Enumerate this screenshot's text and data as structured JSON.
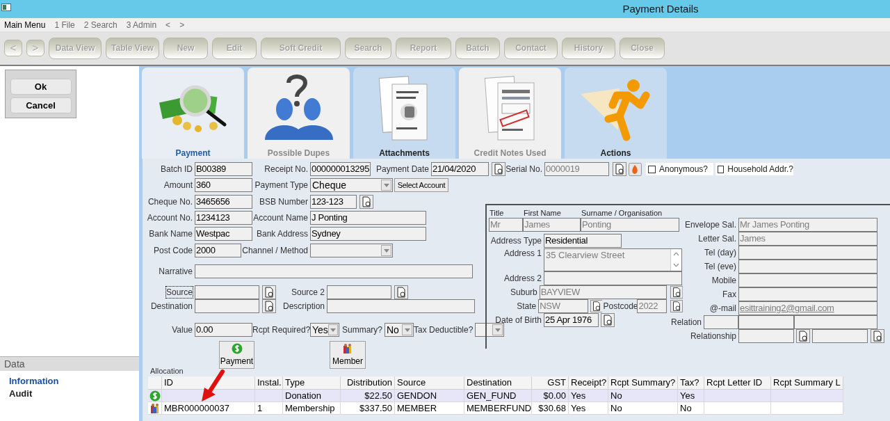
{
  "window": {
    "title": "Payment Details"
  },
  "menu": [
    {
      "label": "Main Menu",
      "selected": true
    },
    {
      "label": "1 File",
      "selected": false
    },
    {
      "label": "2 Search",
      "selected": false
    },
    {
      "label": "3 Admin",
      "selected": false
    },
    {
      "label": "<",
      "selected": false
    },
    {
      "label": ">",
      "selected": false
    }
  ],
  "toolbar": [
    {
      "label": "<",
      "kind": "nav",
      "disabled": true
    },
    {
      "label": ">",
      "kind": "nav",
      "disabled": true
    },
    {
      "label": "Data View",
      "kind": "button",
      "disabled": true
    },
    {
      "label": "Table View",
      "kind": "button",
      "disabled": true
    },
    {
      "label": "New",
      "kind": "button",
      "disabled": true
    },
    {
      "label": "Edit",
      "kind": "button",
      "disabled": true
    },
    {
      "label": "Soft Credit",
      "kind": "button",
      "disabled": true
    },
    {
      "label": "Search",
      "kind": "button",
      "disabled": true
    },
    {
      "label": "Report",
      "kind": "button",
      "disabled": true
    },
    {
      "label": "Batch",
      "kind": "button",
      "disabled": true
    },
    {
      "label": "Contact",
      "kind": "button",
      "disabled": true
    },
    {
      "label": "History",
      "kind": "button",
      "disabled": true
    },
    {
      "label": "Close",
      "kind": "button",
      "disabled": true
    }
  ],
  "dialog_buttons": [
    "Ok",
    "Cancel"
  ],
  "sidebar": {
    "header": "Data",
    "items": [
      {
        "label": "Information",
        "selected": true
      },
      {
        "label": "Audit",
        "selected": false
      }
    ]
  },
  "tabs": [
    {
      "label": "Payment",
      "selected": true,
      "disabled": false
    },
    {
      "label": "Possible Dupes",
      "selected": false,
      "disabled": true
    },
    {
      "label": "Attachments",
      "selected": false,
      "disabled": false
    },
    {
      "label": "Credit Notes Used",
      "selected": false,
      "disabled": true
    },
    {
      "label": "Actions",
      "selected": false,
      "disabled": false
    }
  ],
  "form": {
    "rows": [
      {
        "items": [
          {
            "kind": "label",
            "text": "Batch ID"
          },
          {
            "kind": "field",
            "value": "B00389",
            "disabled": false
          },
          {
            "kind": "label",
            "text": "Receipt No."
          },
          {
            "kind": "field",
            "value": "000000013295",
            "disabled": false
          },
          {
            "kind": "label",
            "text": "Payment Date"
          },
          {
            "kind": "field",
            "value": "21/04/2020",
            "disabled": false
          },
          {
            "kind": "lookup"
          },
          {
            "kind": "label",
            "text": "Serial No."
          },
          {
            "kind": "field",
            "value": "0000019",
            "disabled": true
          },
          {
            "kind": "lookup"
          },
          {
            "kind": "action"
          },
          {
            "kind": "checkbox",
            "text": "Anonymous?",
            "checked": false
          },
          {
            "kind": "checkbox",
            "text": "Household Addr.?",
            "checked": false
          }
        ]
      },
      {
        "items": [
          {
            "kind": "label",
            "text": "Amount"
          },
          {
            "kind": "field",
            "value": "360",
            "disabled": false
          },
          {
            "kind": "label",
            "text": "Payment Type"
          },
          {
            "kind": "select",
            "value": "Cheque"
          },
          {
            "kind": "button",
            "text": "Select Account"
          }
        ]
      },
      {
        "items": [
          {
            "kind": "label",
            "text": "Cheque No."
          },
          {
            "kind": "field",
            "value": "3465656",
            "disabled": false
          },
          {
            "kind": "label",
            "text": "BSB Number"
          },
          {
            "kind": "field",
            "value": "123-123",
            "disabled": false
          },
          {
            "kind": "lookup"
          }
        ]
      },
      {
        "items": [
          {
            "kind": "label",
            "text": "Account No."
          },
          {
            "kind": "field",
            "value": "1234123",
            "disabled": false
          },
          {
            "kind": "label",
            "text": "Account Name"
          },
          {
            "kind": "field",
            "value": "J Ponting",
            "disabled": false
          }
        ]
      },
      {
        "items": [
          {
            "kind": "label",
            "text": "Bank Name"
          },
          {
            "kind": "field",
            "value": "Westpac",
            "disabled": false
          },
          {
            "kind": "label",
            "text": "Bank Address"
          },
          {
            "kind": "field",
            "value": "Sydney",
            "disabled": false
          }
        ]
      },
      {
        "items": [
          {
            "kind": "label",
            "text": "Post Code"
          },
          {
            "kind": "field",
            "value": "2000",
            "disabled": false
          },
          {
            "kind": "label",
            "text": "Channel / Method"
          },
          {
            "kind": "select"
          }
        ]
      },
      {
        "items": [
          {
            "kind": "label",
            "text": "Narrative"
          },
          {
            "kind": "field"
          }
        ]
      },
      {
        "items": [
          {
            "kind": "label",
            "text": "Source",
            "focused": true
          },
          {
            "kind": "field"
          },
          {
            "kind": "lookup"
          },
          {
            "kind": "label",
            "text": "Source 2"
          },
          {
            "kind": "field"
          },
          {
            "kind": "lookup"
          }
        ]
      },
      {
        "items": [
          {
            "kind": "label",
            "text": "Destination"
          },
          {
            "kind": "field"
          },
          {
            "kind": "lookup"
          },
          {
            "kind": "label",
            "text": "Description"
          },
          {
            "kind": "field"
          }
        ]
      },
      {
        "items": [
          {
            "kind": "label",
            "text": "Value"
          },
          {
            "kind": "field",
            "value": "0.00",
            "disabled": false
          },
          {
            "kind": "label",
            "text": "Rcpt Required?"
          },
          {
            "kind": "select",
            "value": "Yes"
          },
          {
            "kind": "label",
            "text": "Summary?"
          },
          {
            "kind": "select",
            "value": "No"
          },
          {
            "kind": "label",
            "text": "Tax Deductible?"
          },
          {
            "kind": "select"
          }
        ]
      }
    ]
  },
  "contact": {
    "name_labels": [
      "Title",
      "First Name",
      "Surname / Organisation"
    ],
    "name_values": [
      {
        "value": "Mr",
        "disabled": true
      },
      {
        "value": "James",
        "disabled": true
      },
      {
        "value": "Ponting",
        "disabled": true
      }
    ],
    "address_type": {
      "label": "Address Type",
      "value": "Residential",
      "disabled": false
    },
    "address1": {
      "label": "Address 1",
      "value": "35 Clearview Street",
      "disabled": true
    },
    "address2": {
      "label": "Address 2"
    },
    "suburb": {
      "label": "Suburb",
      "value": "BAYVIEW",
      "disabled": true
    },
    "state": {
      "label": "State",
      "value": "NSW",
      "disabled": true
    },
    "postcode": {
      "label": "Postcode",
      "value": "2022",
      "disabled": true
    },
    "dob": {
      "label": "Date of Birth",
      "value": "25 Apr 1976",
      "disabled": false
    },
    "right_fields": [
      {
        "label": "Envelope Sal.",
        "value": "Mr James Ponting",
        "kind": "text"
      },
      {
        "label": "Letter Sal.",
        "value": "James",
        "kind": "text"
      },
      {
        "label": "Tel (day)",
        "kind": "text"
      },
      {
        "label": "Tel (eve)",
        "kind": "text"
      },
      {
        "label": "Mobile",
        "kind": "text"
      },
      {
        "label": "Fax",
        "kind": "text"
      },
      {
        "label": "@-mail",
        "value": "esittraining2@gmail.com",
        "kind": "link"
      }
    ],
    "relation_label": "Relation",
    "relationship_label": "Relationship"
  },
  "allocation": {
    "buttons": [
      {
        "label": "Payment",
        "kind": "payment"
      },
      {
        "label": "Member",
        "kind": "member"
      }
    ],
    "label": "Allocation",
    "columns": [
      "ID",
      "Instal.",
      "Type",
      "Distribution",
      "Source",
      "Destination",
      "GST",
      "Receipt?",
      "Rcpt Summary?",
      "Tax?",
      "Rcpt Letter ID",
      "Rcpt Summary L"
    ],
    "rows": [
      {
        "kind": "payment",
        "selected": true,
        "cells": [
          null,
          null,
          "Donation",
          "$22.50",
          "GENDON",
          "GEN_FUND",
          "$0.00",
          "Yes",
          "No",
          "Yes",
          null,
          null
        ]
      },
      {
        "kind": "member",
        "selected": false,
        "cells": [
          "MBR000000037",
          "1",
          "Membership",
          "$337.50",
          "MEMBER",
          "MEMBERFUND",
          "$30.68",
          "Yes",
          "No",
          "No",
          null,
          null
        ]
      }
    ]
  }
}
